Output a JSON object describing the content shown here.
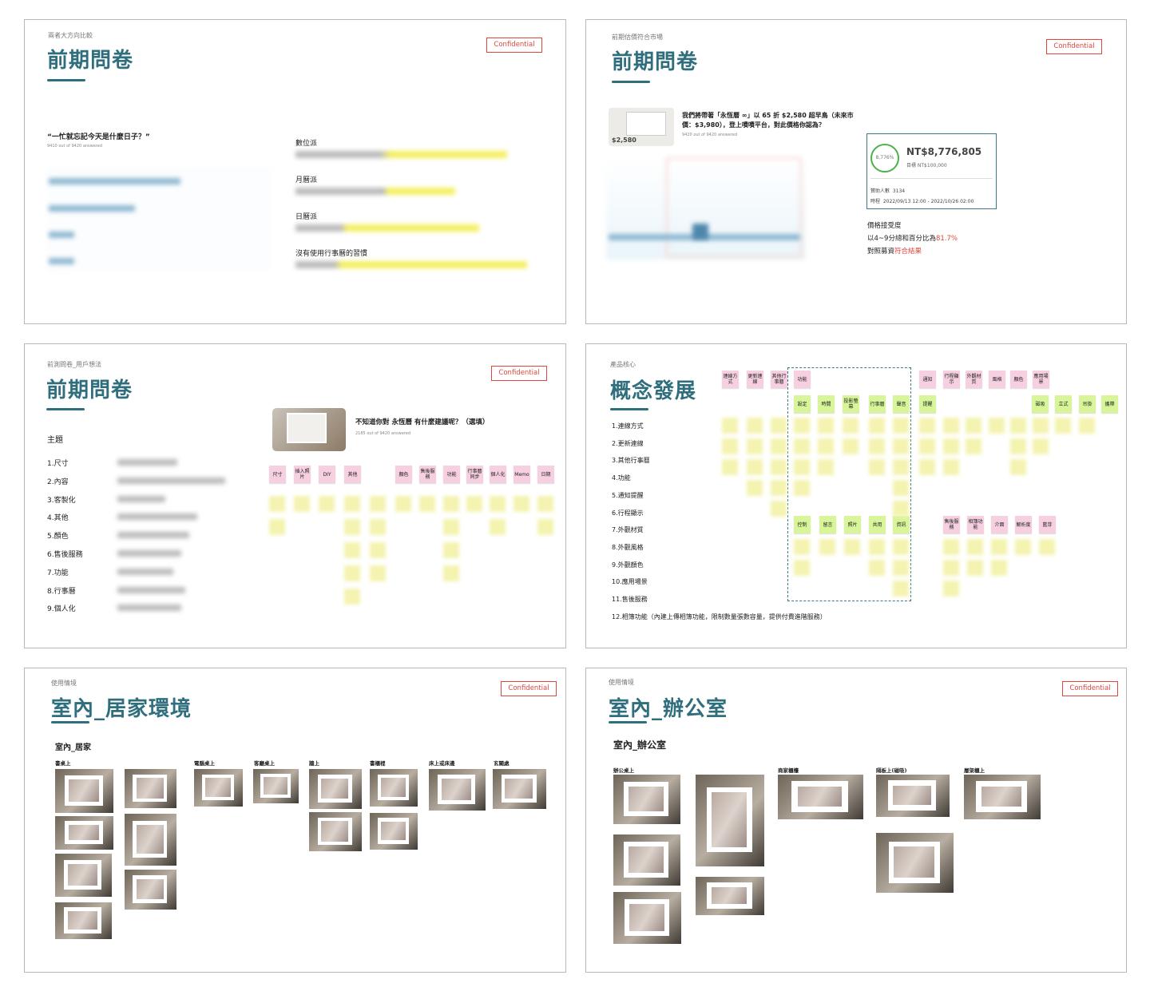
{
  "confidential": "Confidential",
  "slide1": {
    "subtitle": "兩者大方向比較",
    "title": "前期問卷",
    "question": "“一忙就忘記今天是什麼日子？”",
    "answered": "9410 out of 9420 answered",
    "groups": [
      "數位派",
      "月曆派",
      "日曆派",
      "沒有使用行事曆的習慣"
    ]
  },
  "slide2": {
    "subtitle": "前期估價符合市場",
    "title": "前期問卷",
    "product_price": "$2,580",
    "question": "我們將帶著「永恆曆 ∞」以 65 折 $2,580 超早鳥（未來市價：$3,980），登上嘖嘖平台，對此價格你認為？",
    "answered": "9420 out of 9420 answered",
    "funding": {
      "percent": "8,776%",
      "amount": "NT$8,776,805",
      "goal": "目標 NT$100,000",
      "backers_label": "贊助人數",
      "backers": "3134",
      "period_label": "時程",
      "period": "2022/09/13 12:00 - 2022/10/26 02:00"
    },
    "acceptance_title": "價格接受度",
    "acceptance_line": "以4~9分總和百分比為",
    "acceptance_value": "81.7%",
    "compare_line": "對照募資",
    "compare_value": "符合結果"
  },
  "slide3": {
    "subtitle": "前測問卷_用戶想法",
    "title": "前期問卷",
    "topic_heading": "主題",
    "topics": [
      "1.尺寸",
      "2.內容",
      "3.客製化",
      "4.其他",
      "5.顏色",
      "6.售後服務",
      "7.功能",
      "8.行事曆",
      "9.個人化"
    ],
    "question": "不知道你對 永恆曆 有什麼建議呢？（選填）",
    "answered": "2185 out of 9420 answered",
    "tags": [
      "尺寸",
      "插入照片",
      "DIY",
      "其他",
      "顏色",
      "售後服務",
      "功能",
      "行事曆同步",
      "個人化",
      "Memo",
      "日期"
    ]
  },
  "slide4": {
    "subtitle": "產品核心",
    "title": "概念發展",
    "items": [
      "1.連線方式",
      "2.更新連線",
      "3.其他行事曆",
      "4.功能",
      "5.通知提醒",
      "6.行程顯示",
      "7.外觀材質",
      "8.外觀風格",
      "9.外觀顏色",
      "10.應用場景",
      "11.售後服務",
      "12.相簿功能（內建上傳相簿功能，限制數量張數容量，提供付費進階服務）"
    ],
    "pink_top": [
      "連線方式",
      "更新連線",
      "其他行事曆",
      "功能",
      "通知",
      "行程顯示",
      "外觀材質",
      "風格",
      "顏色",
      "應用場景"
    ],
    "green_row": [
      "設定",
      "時間",
      "投影螢幕",
      "行事曆",
      "聲音",
      "提醒",
      "磁吸",
      "立式",
      "吊掛",
      "攜帶"
    ],
    "green_row2": [
      "控制",
      "留言",
      "照片",
      "共用",
      "資訊"
    ],
    "pink_row2": [
      "售後服務",
      "相簿功能",
      "介面",
      "解析度",
      "藍芽"
    ]
  },
  "slide5": {
    "subtitle": "使用情境",
    "title": "室內_居家環境",
    "section": "室內_居家",
    "categories": [
      "書桌上",
      "電腦桌上",
      "客廳桌上",
      "牆上",
      "書櫃裡",
      "床上或床邊",
      "玄關處"
    ]
  },
  "slide6": {
    "subtitle": "使用情境",
    "title": "室內_辦公室",
    "section": "室內_辦公室",
    "categories": [
      "辦公桌上",
      "商家櫃檯",
      "隔板上(磁吸)",
      "層架櫃上"
    ]
  }
}
